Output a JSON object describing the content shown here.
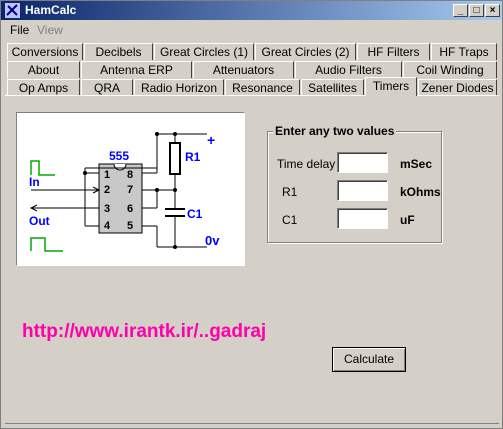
{
  "window": {
    "title": "HamCalc",
    "controls": {
      "minimize": "_",
      "maximize": "□",
      "close": "×"
    }
  },
  "menu": {
    "file": "File",
    "view": "View"
  },
  "tabs": {
    "row1": [
      "Conversions",
      "Decibels",
      "Great Circles (1)",
      "Great Circles (2)",
      "HF Filters",
      "HF Traps"
    ],
    "row2": [
      "About",
      "Antenna ERP",
      "Attenuators",
      "Audio Filters",
      "Coil Winding"
    ],
    "row3": [
      "Op Amps",
      "QRA",
      "Radio Horizon",
      "Resonance",
      "Satellites",
      "Timers",
      "Zener Diodes"
    ],
    "active": "Timers"
  },
  "diagram": {
    "chip_label": "555",
    "plus": "+",
    "r1": "R1",
    "c1": "C1",
    "zero_v": "0v",
    "in": "In",
    "out": "Out",
    "pins": [
      "1",
      "2",
      "3",
      "4",
      "5",
      "6",
      "7",
      "8"
    ]
  },
  "group": {
    "title": "Enter any two values",
    "rows": [
      {
        "label": "Time delay",
        "value": "",
        "unit": "mSec"
      },
      {
        "label": "R1",
        "value": "",
        "unit": "kOhms"
      },
      {
        "label": "C1",
        "value": "",
        "unit": "uF"
      }
    ]
  },
  "url_text": "http://www.irantk.ir/..gadraj",
  "calculate_label": "Calculate",
  "colors": {
    "accent_blue": "#0000ff",
    "url_pink": "#ff00aa",
    "title_bar": "#0a246a",
    "schematic_green": "#00aa00"
  }
}
